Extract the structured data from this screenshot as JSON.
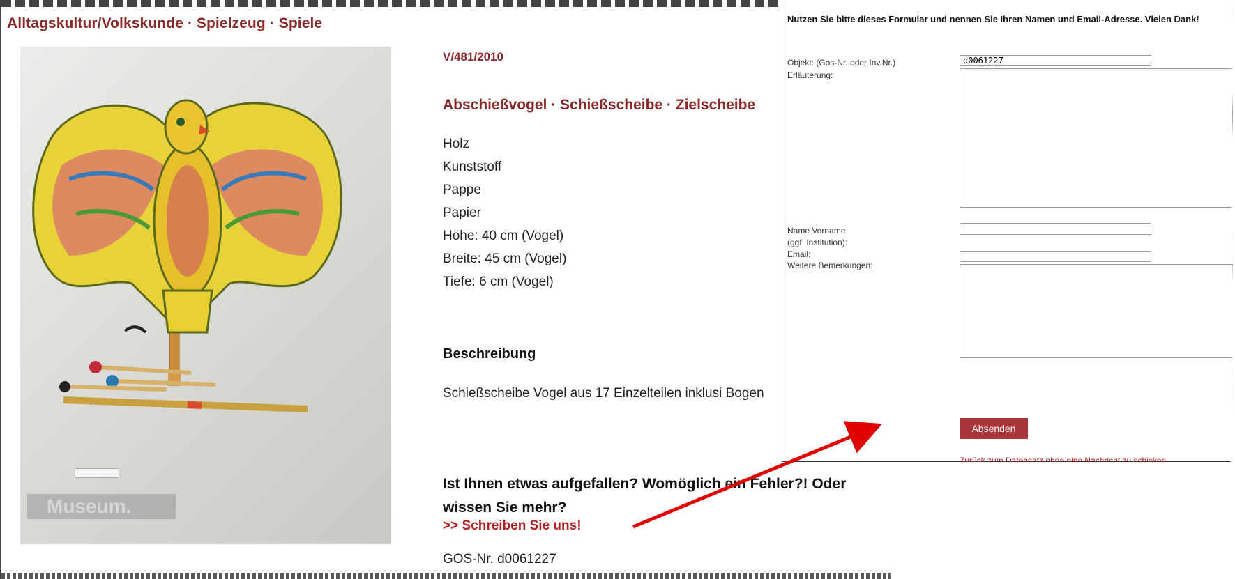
{
  "main": {
    "breadcrumb": "Alltagskultur/Volkskunde · Spielzeug · Spiele",
    "inventory_number": "V/481/2010",
    "title": "Abschießvogel · Schießscheibe · Zielscheibe",
    "materials": [
      "Holz",
      "Kunststoff",
      "Pappe",
      "Papier",
      "Höhe: 40 cm (Vogel)",
      "Breite: 45 cm (Vogel)",
      "Tiefe: 6 cm (Vogel)"
    ],
    "description_heading": "Beschreibung",
    "description_text": "Schießscheibe Vogel aus 17 Einzelteilen inklusi Bogen",
    "question_text": "Ist Ihnen etwas aufgefallen? Womöglich ein Fehler?! Oder wissen Sie mehr?",
    "write_link": ">> Schreiben Sie uns!",
    "gos_number": "GOS-Nr. d0061227",
    "photo_watermark": "Museum."
  },
  "form": {
    "intro": "Nutzen Sie bitte dieses Formular und nennen Sie Ihren Namen und Email-Adresse. Vielen Dank!",
    "object_label": "Objekt: (Gos-Nr. oder Inv.Nr.)",
    "object_value": "d0061227",
    "explanation_label": "Erläuterung:",
    "name_label_line1": "Name Vorname",
    "name_label_line2": "(ggf. Institution):",
    "email_label": "Email:",
    "remarks_label": "Weitere Bemerkungen:",
    "submit_label": "Absenden",
    "back_link": "Zurück zum Datensatz ohne eine Nachricht zu schicken"
  },
  "colors": {
    "accent": "#8b2a2a",
    "button": "#a8353a",
    "link": "#b02020",
    "arrow": "#e00000"
  }
}
